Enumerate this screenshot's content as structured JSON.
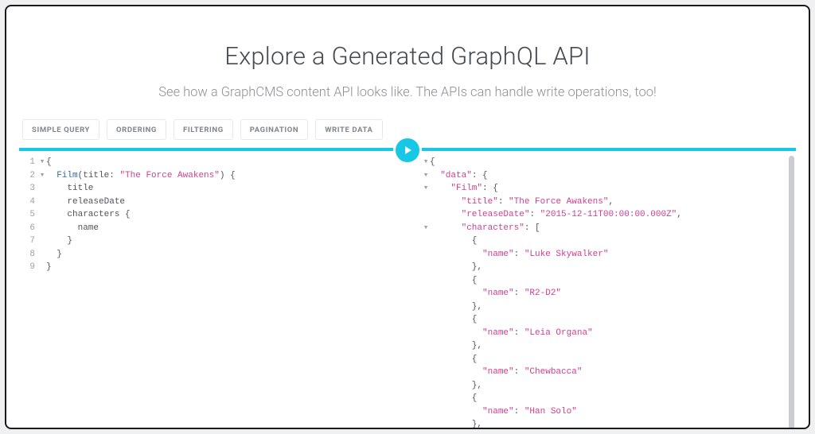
{
  "hero": {
    "title": "Explore a Generated GraphQL API",
    "subtitle": "See how a GraphCMS content API looks like. The APIs can handle write operations, too!"
  },
  "tabs": [
    {
      "label": "SIMPLE QUERY"
    },
    {
      "label": "ORDERING"
    },
    {
      "label": "FILTERING"
    },
    {
      "label": "PAGINATION"
    },
    {
      "label": "WRITE DATA"
    }
  ],
  "query": {
    "lines": [
      {
        "n": 1,
        "fold": "▾",
        "tokens": [
          [
            "punc",
            "{"
          ]
        ]
      },
      {
        "n": 2,
        "fold": "▾",
        "tokens": [
          [
            "neutral",
            "  "
          ],
          [
            "kw",
            "Film"
          ],
          [
            "punc",
            "("
          ],
          [
            "neutral",
            "title"
          ],
          [
            "punc",
            ": "
          ],
          [
            "str",
            "\"The Force Awakens\""
          ],
          [
            "punc",
            ")"
          ],
          [
            "punc",
            " {"
          ]
        ]
      },
      {
        "n": 3,
        "fold": "",
        "tokens": [
          [
            "neutral",
            "    "
          ],
          [
            "neutral",
            "title"
          ]
        ]
      },
      {
        "n": 4,
        "fold": "",
        "tokens": [
          [
            "neutral",
            "    "
          ],
          [
            "neutral",
            "releaseDate"
          ]
        ]
      },
      {
        "n": 5,
        "fold": "",
        "tokens": [
          [
            "neutral",
            "    "
          ],
          [
            "neutral",
            "characters {"
          ]
        ]
      },
      {
        "n": 6,
        "fold": "",
        "tokens": [
          [
            "neutral",
            "      "
          ],
          [
            "neutral",
            "name"
          ]
        ]
      },
      {
        "n": 7,
        "fold": "",
        "tokens": [
          [
            "neutral",
            "    "
          ],
          [
            "punc",
            "}"
          ]
        ]
      },
      {
        "n": 8,
        "fold": "",
        "tokens": [
          [
            "neutral",
            "  "
          ],
          [
            "punc",
            "}"
          ]
        ]
      },
      {
        "n": 9,
        "fold": "",
        "tokens": [
          [
            "punc",
            "}"
          ]
        ]
      }
    ]
  },
  "response": {
    "lines": [
      {
        "fold": "▾",
        "tokens": [
          [
            "punc",
            "{"
          ]
        ]
      },
      {
        "fold": "▾",
        "tokens": [
          [
            "punc",
            "  "
          ],
          [
            "str",
            "\"data\""
          ],
          [
            "punc",
            ": {"
          ]
        ]
      },
      {
        "fold": "▾",
        "tokens": [
          [
            "punc",
            "    "
          ],
          [
            "str",
            "\"Film\""
          ],
          [
            "punc",
            ": {"
          ]
        ]
      },
      {
        "fold": "",
        "tokens": [
          [
            "punc",
            "      "
          ],
          [
            "str",
            "\"title\""
          ],
          [
            "punc",
            ": "
          ],
          [
            "str",
            "\"The Force Awakens\""
          ],
          [
            "punc",
            ","
          ]
        ]
      },
      {
        "fold": "",
        "tokens": [
          [
            "punc",
            "      "
          ],
          [
            "str",
            "\"releaseDate\""
          ],
          [
            "punc",
            ": "
          ],
          [
            "str",
            "\"2015-12-11T00:00:00.000Z\""
          ],
          [
            "punc",
            ","
          ]
        ]
      },
      {
        "fold": "▾",
        "tokens": [
          [
            "punc",
            "      "
          ],
          [
            "str",
            "\"characters\""
          ],
          [
            "punc",
            ": ["
          ]
        ]
      },
      {
        "fold": "",
        "tokens": [
          [
            "punc",
            "        {"
          ]
        ]
      },
      {
        "fold": "",
        "tokens": [
          [
            "punc",
            "          "
          ],
          [
            "str",
            "\"name\""
          ],
          [
            "punc",
            ": "
          ],
          [
            "str",
            "\"Luke Skywalker\""
          ]
        ]
      },
      {
        "fold": "",
        "tokens": [
          [
            "punc",
            "        },"
          ]
        ]
      },
      {
        "fold": "",
        "tokens": [
          [
            "punc",
            "        {"
          ]
        ]
      },
      {
        "fold": "",
        "tokens": [
          [
            "punc",
            "          "
          ],
          [
            "str",
            "\"name\""
          ],
          [
            "punc",
            ": "
          ],
          [
            "str",
            "\"R2-D2\""
          ]
        ]
      },
      {
        "fold": "",
        "tokens": [
          [
            "punc",
            "        },"
          ]
        ]
      },
      {
        "fold": "",
        "tokens": [
          [
            "punc",
            "        {"
          ]
        ]
      },
      {
        "fold": "",
        "tokens": [
          [
            "punc",
            "          "
          ],
          [
            "str",
            "\"name\""
          ],
          [
            "punc",
            ": "
          ],
          [
            "str",
            "\"Leia Organa\""
          ]
        ]
      },
      {
        "fold": "",
        "tokens": [
          [
            "punc",
            "        },"
          ]
        ]
      },
      {
        "fold": "",
        "tokens": [
          [
            "punc",
            "        {"
          ]
        ]
      },
      {
        "fold": "",
        "tokens": [
          [
            "punc",
            "          "
          ],
          [
            "str",
            "\"name\""
          ],
          [
            "punc",
            ": "
          ],
          [
            "str",
            "\"Chewbacca\""
          ]
        ]
      },
      {
        "fold": "",
        "tokens": [
          [
            "punc",
            "        },"
          ]
        ]
      },
      {
        "fold": "",
        "tokens": [
          [
            "punc",
            "        {"
          ]
        ]
      },
      {
        "fold": "",
        "tokens": [
          [
            "punc",
            "          "
          ],
          [
            "str",
            "\"name\""
          ],
          [
            "punc",
            ": "
          ],
          [
            "str",
            "\"Han Solo\""
          ]
        ]
      },
      {
        "fold": "",
        "tokens": [
          [
            "punc",
            "        },"
          ]
        ]
      }
    ]
  },
  "colors": {
    "accent": "#17c7e6",
    "string": "#d13e8e",
    "keyword": "#2e6aa3"
  }
}
